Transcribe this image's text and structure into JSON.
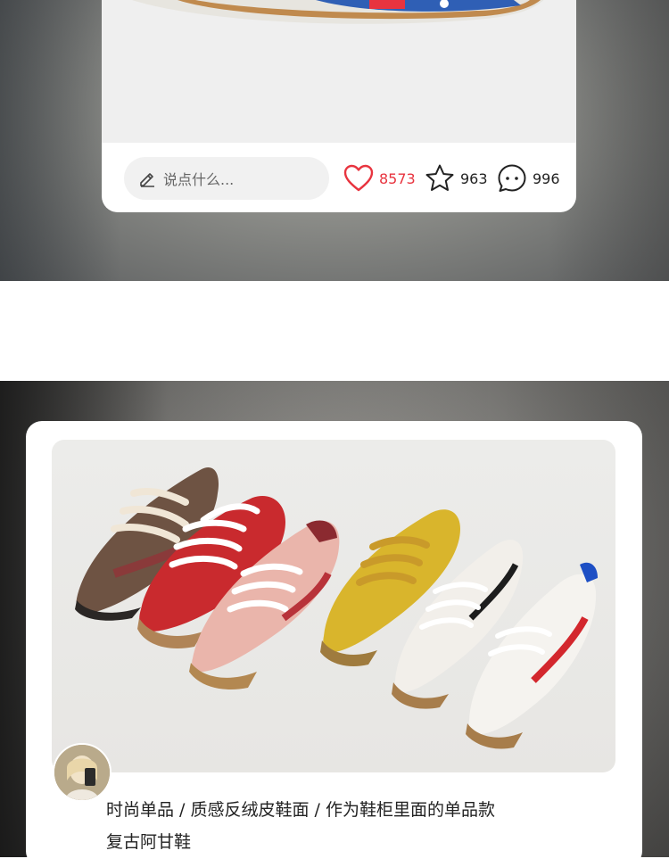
{
  "post_top": {
    "comment_placeholder": "说点什么...",
    "likes": "8573",
    "favorites": "963",
    "comments": "996",
    "like_color": "#e8343f"
  },
  "post_bottom": {
    "caption_line1": "时尚单品 / 质感反绒皮鞋面 / 作为鞋柜里面的单品款",
    "caption_line2": "复古阿甘鞋"
  },
  "icons": [
    "edit-pen-icon",
    "heart-icon",
    "star-icon",
    "comment-bubble-icon"
  ]
}
